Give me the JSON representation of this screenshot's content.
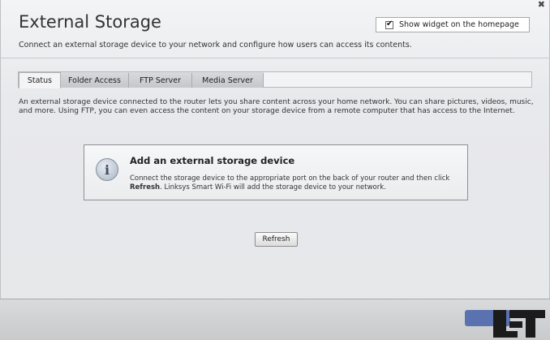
{
  "window": {
    "title": "External Storage",
    "subtitle": "Connect an external storage device to your network and configure how users can access its contents.",
    "close_label": "✖"
  },
  "widget": {
    "label": "Show widget on the homepage",
    "checked": true
  },
  "tabs": [
    {
      "label": "Status",
      "active": true
    },
    {
      "label": "Folder Access",
      "active": false
    },
    {
      "label": "FTP Server",
      "active": false
    },
    {
      "label": "Media Server",
      "active": false
    }
  ],
  "intro": "An external storage device connected to the router lets you share content across your home network. You can share pictures, videos, music, and more. Using FTP, you can even access the content on your storage device from a remote computer that has access to the Internet.",
  "info": {
    "icon": "info-icon",
    "icon_glyph": "i",
    "heading": "Add an external storage device",
    "text_before": "Connect the storage device to the appropriate port on the back of your router and then click ",
    "text_bold": "Refresh",
    "text_after": ". Linksys Smart Wi-Fi will add the storage device to your network."
  },
  "refresh_label": "Refresh",
  "colors": {
    "ok_button": "#5a73b0",
    "watermark": "#1b1b1b"
  }
}
